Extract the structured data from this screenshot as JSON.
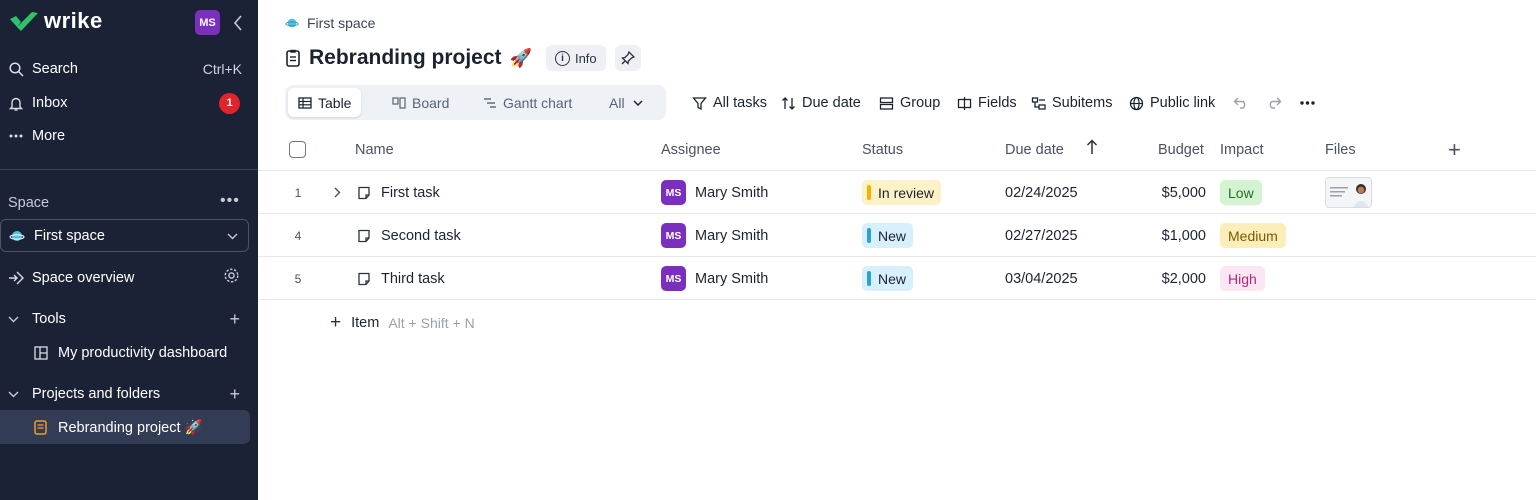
{
  "sidebar": {
    "logo": "wrike",
    "user_initials": "MS",
    "search": {
      "label": "Search",
      "shortcut": "Ctrl+K"
    },
    "inbox": {
      "label": "Inbox",
      "badge": "1"
    },
    "more": {
      "label": "More"
    },
    "space_section": "Space",
    "space_selected": "First space",
    "space_overview": "Space overview",
    "tools": "Tools",
    "dashboard": "My productivity dashboard",
    "projects_folders": "Projects and folders",
    "active_project": "Rebranding project 🚀"
  },
  "header": {
    "breadcrumb": "First space",
    "title": "Rebranding project",
    "title_emoji": "🚀",
    "info_label": "Info"
  },
  "views": {
    "table": "Table",
    "board": "Board",
    "gantt": "Gantt chart",
    "all": "All"
  },
  "toolbar": {
    "all_tasks": "All tasks",
    "due_date": "Due date",
    "group": "Group",
    "fields": "Fields",
    "subitems": "Subitems",
    "public_link": "Public link"
  },
  "table": {
    "columns": {
      "name": "Name",
      "assignee": "Assignee",
      "status": "Status",
      "due_date": "Due date",
      "budget": "Budget",
      "impact": "Impact",
      "files": "Files"
    },
    "rows": [
      {
        "num": "1",
        "name": "First task",
        "initials": "MS",
        "assignee": "Mary Smith",
        "status": "In review",
        "due": "02/24/2025",
        "budget": "$5,000",
        "impact": "Low"
      },
      {
        "num": "4",
        "name": "Second task",
        "initials": "MS",
        "assignee": "Mary Smith",
        "status": "New",
        "due": "02/27/2025",
        "budget": "$1,000",
        "impact": "Medium"
      },
      {
        "num": "5",
        "name": "Third task",
        "initials": "MS",
        "assignee": "Mary Smith",
        "status": "New",
        "due": "03/04/2025",
        "budget": "$2,000",
        "impact": "High"
      }
    ],
    "add_item": "Item",
    "add_item_hint": "Alt + Shift + N"
  },
  "colors": {
    "sidebar_bg": "#1b2236",
    "accent_green": "#2ec26b",
    "avatar_purple": "#7b2fbe",
    "status_in_review": "#fdf1c7",
    "status_new": "#d7f0fb",
    "impact_low": "#d4f3d0",
    "impact_medium": "#fbeeb8",
    "impact_high": "#fde6f3"
  }
}
